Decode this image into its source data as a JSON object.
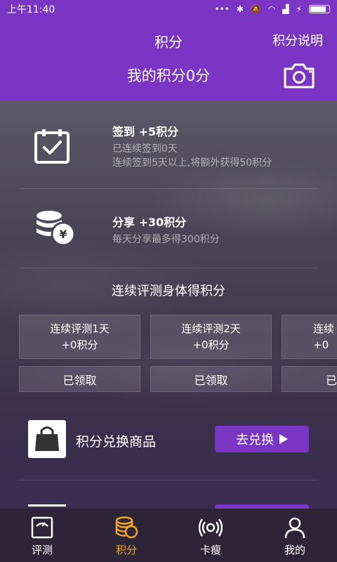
{
  "status_bar": {
    "time": "上午11:40"
  },
  "header": {
    "title": "积分",
    "rules_link": "积分说明",
    "my_points": "我的积分0分"
  },
  "tasks": [
    {
      "title": "签到 +5积分",
      "lines": [
        "已连续签到0天",
        "连续签到5天以上,将额外获得50积分"
      ],
      "icon": "calendar-check-icon"
    },
    {
      "title": "分享 +30积分",
      "lines": [
        "每天分享最多得300积分"
      ],
      "icon": "coins-yen-icon"
    }
  ],
  "streak": {
    "section_title": "连续评测身体得积分",
    "cards": [
      {
        "day": "连续评测1天",
        "points": "+0积分",
        "button": "已领取"
      },
      {
        "day": "连续评测2天",
        "points": "+0积分",
        "button": "已领取"
      },
      {
        "day": "连续",
        "points": "+0",
        "button": "已"
      }
    ]
  },
  "shop": {
    "label": "积分兑换商品",
    "button": "去兑换",
    "icon": "shopping-bag-icon"
  },
  "nav": [
    {
      "label": "评测",
      "icon": "scale-icon",
      "active": false
    },
    {
      "label": "积分",
      "icon": "coins-icon",
      "active": true
    },
    {
      "label": "卡瘦",
      "icon": "signal-icon",
      "active": false
    },
    {
      "label": "我的",
      "icon": "user-icon",
      "active": false
    }
  ],
  "colors": {
    "brand": "#7b35c4",
    "active_nav": "#f5a623",
    "nav_bg": "#2d2438"
  }
}
